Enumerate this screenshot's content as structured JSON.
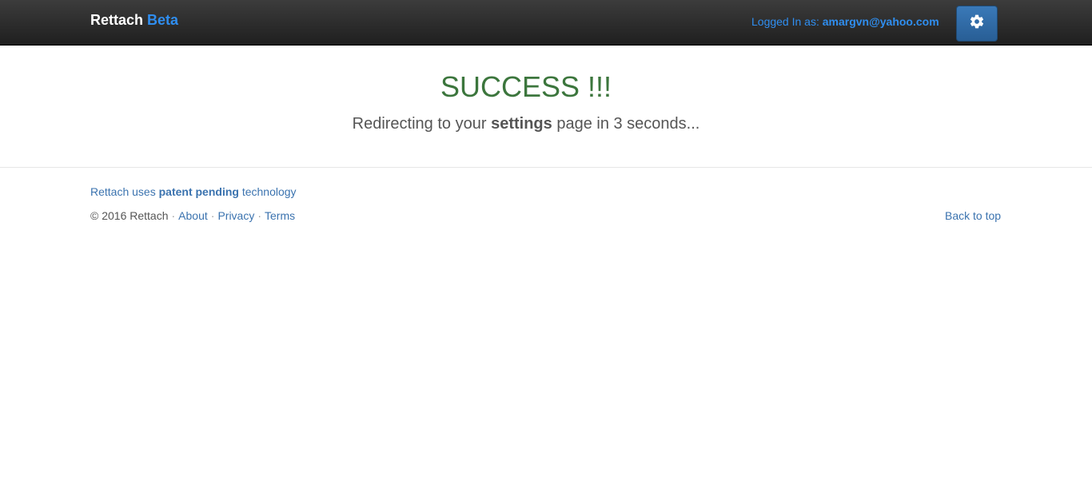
{
  "navbar": {
    "brand_name": "Rettach",
    "brand_suffix": "Beta",
    "logged_in_label": "Logged In as:",
    "user_email": "amargvn@yahoo.com",
    "settings_icon": "gear-icon"
  },
  "main": {
    "headline": "SUCCESS !!!",
    "redirect_prefix": "Redirecting to your",
    "redirect_bold": "settings",
    "redirect_suffix": "page in 3 seconds..."
  },
  "footer": {
    "patent_prefix": "Rettach uses",
    "patent_bold": "patent pending",
    "patent_suffix": "technology",
    "copyright": "© 2016 Rettach",
    "links": [
      "About",
      "Privacy",
      "Terms"
    ],
    "back_to_top": "Back to top"
  },
  "colors": {
    "navbar_bg": "#2b2b2b",
    "accent_blue": "#2f8ef0",
    "success_green": "#3c763d",
    "link_blue": "#3b73af"
  }
}
